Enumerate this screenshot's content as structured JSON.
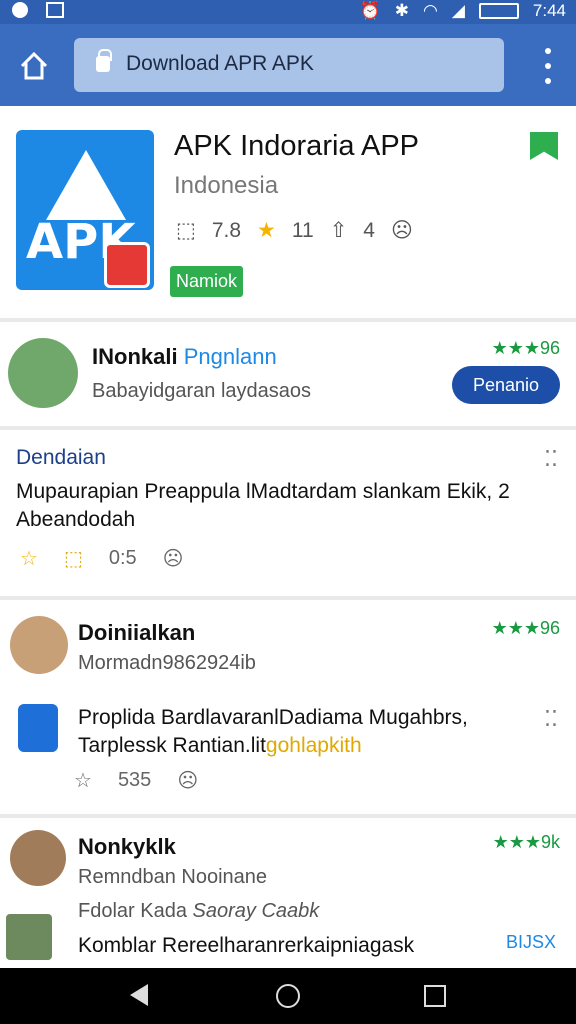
{
  "status_bar": {
    "time": "7:44",
    "icons": [
      "notification-dot-icon",
      "image-icon",
      "alarm-icon",
      "bluetooth-icon",
      "wifi-icon",
      "signal-icon",
      "battery-icon"
    ]
  },
  "browser": {
    "url_text": "Download APR APK"
  },
  "app": {
    "title": "APK Indoraria APP",
    "subtitle": "Indonesia",
    "stat_install": "7.8",
    "stat_rating": "11",
    "stat_share": "4",
    "tag": "Namiok",
    "icon_text": "APK"
  },
  "review1": {
    "name": "INonkali",
    "name_extra": "Pngnlann",
    "subtitle": "Babayidgaran laydasaos",
    "rating": "★★★96",
    "button": "Penanio"
  },
  "post": {
    "header": "Dendaian",
    "body": "Mupaurapian Preappula lMadtardam slankam Ekik,  2 Abeandodah",
    "count": "0:5"
  },
  "review2": {
    "name": "Doiniialkan",
    "subtitle": "Mormadn9862924ib",
    "rating": "★★★96",
    "body": "Proplida BardlavaranlDadiama Mugahbrs, Tarplessk Rantian.lit",
    "body_highlight": "gohlapkith",
    "count": "535"
  },
  "review3": {
    "name": "Nonkyklk",
    "subtitle": "Remndban Nooinane",
    "line2": "Fdolar Kada",
    "line2b": "Saoray Caabk",
    "rating": "★★★9k",
    "body": "Komblar Rereelharanrerkaipniagask",
    "tag": "BIJSX"
  },
  "colors": {
    "toolbar": "#3a6cc0",
    "accent_green": "#2eae4f",
    "accent_blue": "#1e4fa8"
  }
}
